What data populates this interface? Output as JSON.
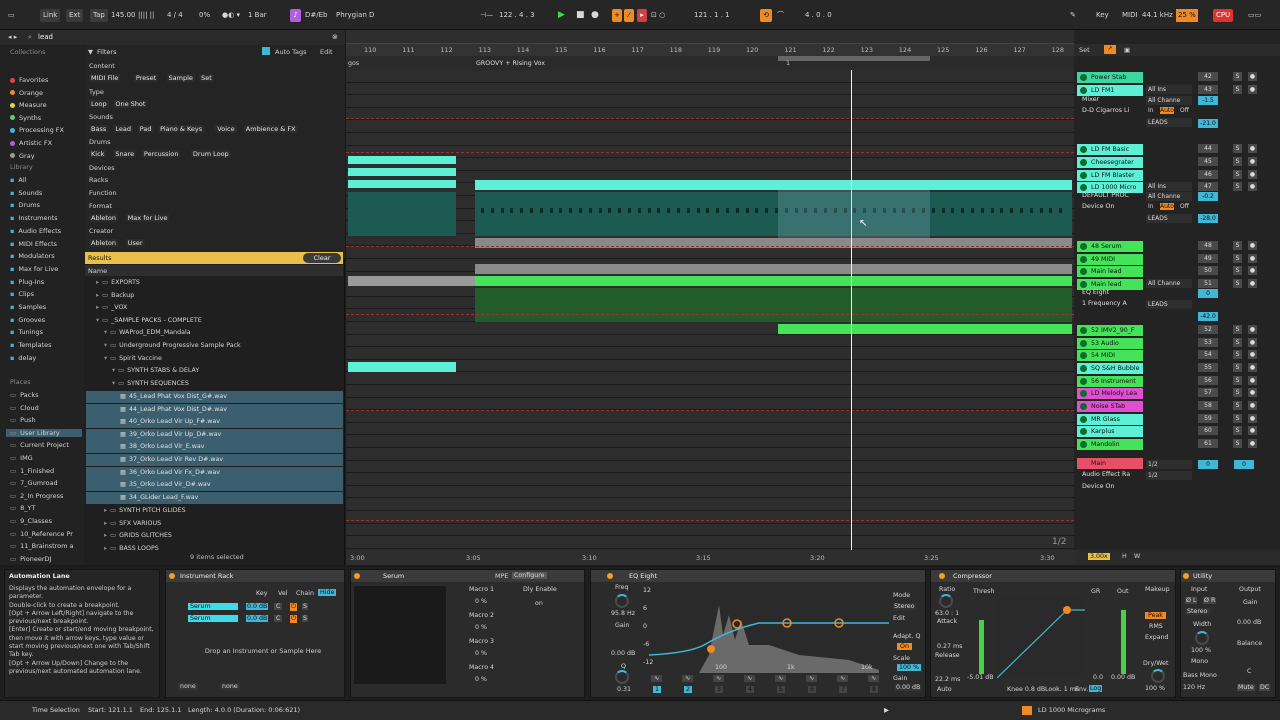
{
  "topbar": {
    "link": "Link",
    "ext": "Ext",
    "tap": "Tap",
    "tempo": "145.00",
    "meter": "4 / 4",
    "percent": "0%",
    "quant": "1 Bar",
    "key": "D#/Eb",
    "scale": "Phrygian D",
    "position": "122 .   4 .   3",
    "loop_start": "121 .   1 .   1",
    "loop_len": "4 .   0 .   0",
    "key_label": "Key",
    "midi_label": "MIDI",
    "samplerate": "44.1 kHz",
    "cpu_pct": "25 %",
    "cpu": "CPU"
  },
  "browser": {
    "search": "lead",
    "collections_title": "Collections",
    "collections": [
      {
        "label": "Favorites",
        "color": "#e04545"
      },
      {
        "label": "Orange",
        "color": "#f08a24"
      },
      {
        "label": "Measure",
        "color": "#e8d23a"
      },
      {
        "label": "Synths",
        "color": "#5fd35f"
      },
      {
        "label": "Processing FX",
        "color": "#3fb7d7"
      },
      {
        "label": "Artistic FX",
        "color": "#b05fe0"
      },
      {
        "label": "Gray",
        "color": "#9a9a9a"
      }
    ],
    "library_title": "Library",
    "library": [
      "All",
      "Sounds",
      "Drums",
      "Instruments",
      "Audio Effects",
      "MIDI Effects",
      "Modulators",
      "Max for Live",
      "Plug-Ins",
      "Clips",
      "Samples",
      "Grooves",
      "Tunings",
      "Templates",
      "delay"
    ],
    "places_title": "Places",
    "places": [
      "Packs",
      "Cloud",
      "Push",
      "User Library",
      "Current Project",
      "IMG",
      "1_Finished",
      "7_Gumroad",
      "2_In Progress",
      "8_YT",
      "9_Classes",
      "10_Reference Pr",
      "11_Brainstrom a",
      "PioneerDJ"
    ],
    "filters_label": "Filters",
    "autotags": "Auto Tags",
    "edit": "Edit",
    "content_label": "Content",
    "content": [
      "MIDI File",
      "Preset",
      "Sample",
      "Set"
    ],
    "type_label": "Type",
    "type": [
      "Loop",
      "One Shot"
    ],
    "sounds_label": "Sounds",
    "sounds": [
      "Bass",
      "Lead",
      "Pad",
      "Piano & Keys",
      "Voice",
      "Ambience & FX"
    ],
    "drums_label": "Drums",
    "drums": [
      "Kick",
      "Snare",
      "Percussion",
      "Drum Loop"
    ],
    "devices_label": "Devices",
    "racks": "Racks",
    "function_label": "Function",
    "format_label": "Format",
    "format": [
      "Ableton",
      "Max for Live"
    ],
    "creator_label": "Creator",
    "creator": [
      "Ableton",
      "User"
    ],
    "results": "Results",
    "clear": "Clear",
    "name_col": "Name",
    "tree": [
      "EXPORTS",
      "Backup",
      "_VOX",
      "_SAMPLE PACKS - COMPLETE",
      "WAProd_EDM_Mandala",
      "Underground Progressive Sample Pack",
      "Spirit Vaccine",
      "SYNTH STABS & DELAY",
      "SYNTH SEQUENCES"
    ],
    "files": [
      "45_Lead Phat Vox Dist_G#.wav",
      "44_Lead Phat Vox Dist_D#.wav",
      "40_Orko Lead Vir Up_F#.wav",
      "39_Orko Lead Vir Up_D#.wav",
      "38_Orko Lead Vir_E.wav",
      "37_Orko Lead Vir Rev D#.wav",
      "36_Orko Lead Vir Fx_D#.wav",
      "35_Orko Lead Vir_D#.wav",
      "34_GLider Lead_F.wav"
    ],
    "tree2": [
      "SYNTH PITCH GLIDES",
      "SFX VARIOUS",
      "GRIDS GLITCHES",
      "BASS LOOPS"
    ],
    "selected": "9 items selected"
  },
  "arrangement": {
    "bars": [
      "110",
      "111",
      "112",
      "113",
      "114",
      "115",
      "116",
      "117",
      "118",
      "119",
      "120",
      "121",
      "122",
      "123",
      "124",
      "125",
      "126",
      "127",
      "128"
    ],
    "locator": "GROOVY + RIsing Vox",
    "locator2": "gos",
    "loop_marker": "1",
    "times": [
      "3:00",
      "3:05",
      "3:10",
      "3:15",
      "3:20",
      "3:25",
      "3:30"
    ],
    "page": "1/2"
  },
  "mixer": {
    "set": "Set",
    "tracks": [
      {
        "name": "Power Stab",
        "color": "#3dd6a0",
        "num": "42"
      },
      {
        "name": "LD FM1",
        "color": "#5df0d6",
        "num": "43",
        "input": "All Ins"
      },
      {
        "name": "LD FM Basic",
        "color": "#5df0d6",
        "num": "44"
      },
      {
        "name": "Cheesegrater",
        "color": "#5df0d6",
        "num": "45"
      },
      {
        "name": "LD FM Blaster",
        "color": "#5df0d6",
        "num": "46"
      },
      {
        "name": "LD 1000 Micro",
        "color": "#5df0d6",
        "num": "47",
        "input": "All Ins"
      },
      {
        "name": "48 Serum",
        "color": "#44e35a",
        "num": "48"
      },
      {
        "name": "49 MIDI",
        "color": "#44e35a",
        "num": "49"
      },
      {
        "name": "Main lead",
        "color": "#44e35a",
        "num": "50"
      },
      {
        "name": "Main lead",
        "color": "#44e35a",
        "num": "51",
        "input": "All Channe"
      },
      {
        "name": "52 IMV2_90_F",
        "color": "#44e35a",
        "num": "52"
      },
      {
        "name": "53 Audio",
        "color": "#44e35a",
        "num": "53"
      },
      {
        "name": "54 MIDI",
        "color": "#44e35a",
        "num": "54"
      },
      {
        "name": "SQ S&H Bubble",
        "color": "#5df0d6",
        "num": "55"
      },
      {
        "name": "56 Instrument",
        "color": "#44e35a",
        "num": "56"
      },
      {
        "name": "LD Melody Lea",
        "color": "#e04fd0",
        "num": "57"
      },
      {
        "name": "Noise STab",
        "color": "#e04fd0",
        "num": "58"
      },
      {
        "name": "MR Glass",
        "color": "#5df0d6",
        "num": "59"
      },
      {
        "name": "Karplus",
        "color": "#5df0d6",
        "num": "60"
      },
      {
        "name": "Mandolin",
        "color": "#44e35a",
        "num": "61"
      }
    ],
    "sub1": [
      "Mixer",
      "D-D Cigarros Li"
    ],
    "sub2": [
      "DEFAULT PROC",
      "Device On"
    ],
    "sub3": [
      "EQ Eight",
      "1 Frequency A"
    ],
    "routing": {
      "all_chan": "All Channe",
      "in": "In",
      "auto": "Auto",
      "off": "Off",
      "leads": "LEADS",
      "v1": "-1.5",
      "v2": "-21.0",
      "v3": "-0.2",
      "v4": "-28.0",
      "v5": "0",
      "v6": "-42.0",
      "c": "C",
      "inf": "-∞"
    },
    "main": {
      "name": "Main",
      "effect": "Audio Effect Ra",
      "device_on": "Device On",
      "io1": "1/2",
      "io2": "1/2",
      "vol": "0",
      "vol2": "0"
    },
    "zoom": "3.00x",
    "h": "H",
    "w": "W"
  },
  "info": {
    "title": "Automation Lane",
    "text": "Displays the automation envelope for a parameter.\nDouble-click to create a breakpoint.\n[Opt + Arrow Left/Right] navigate to the previous/next breakpoint.\n[Enter] Create or start/end moving breakpoint, then move it with arrow keys, type value or start moving previous/next one with Tab/Shift Tab key.\n[Opt + Arrow Up/Down] Change to the previous/next automated automation lane."
  },
  "rack": {
    "title": "Instrument Rack",
    "key": "Key",
    "vel": "Vel",
    "chain": "Chain",
    "hide": "Hide",
    "chains": [
      {
        "name": "Serum",
        "vol": "0.0 dB",
        "pan": "C"
      },
      {
        "name": "Serum",
        "vol": "0.0 dB",
        "pan": "C"
      }
    ],
    "drop": "Drop an Instrument or Sample Here",
    "none1": "none",
    "none2": "none"
  },
  "serum": {
    "title": "Serum",
    "mpe": "MPE",
    "configure": "Configure",
    "macros": [
      {
        "name": "Macro 1",
        "val": "0 %"
      },
      {
        "name": "Macro 2",
        "val": "0 %"
      },
      {
        "name": "Macro 3",
        "val": "0 %"
      },
      {
        "name": "Macro 4",
        "val": "0 %"
      }
    ],
    "dly": "Dly Enable",
    "on": "on"
  },
  "eq": {
    "title": "EQ Eight",
    "freq": "Freq",
    "freq_v": "95.8 Hz",
    "gain": "Gain",
    "gain_v": "0.00 dB",
    "q": "Q",
    "q_v": "0.31",
    "db": [
      "12",
      "6",
      "0",
      "-6",
      "-12"
    ],
    "hz": [
      "100",
      "1k",
      "10k"
    ],
    "mode": "Mode",
    "stereo": "Stereo",
    "edit": "Edit",
    "adapt": "Adapt. Q",
    "on": "On",
    "scale": "Scale",
    "scale_v": "100 %",
    "gain2": "Gain",
    "gain2_v": "0.00 dB",
    "bands": [
      "1",
      "2",
      "3",
      "4",
      "5",
      "6",
      "7",
      "8"
    ],
    "side": "DEFAULT P..."
  },
  "comp": {
    "title": "Compressor",
    "ratio": "Ratio",
    "ratio_v": "63.0 : 1",
    "attack": "Attack",
    "attack_v": "0.27 ms",
    "release": "Release",
    "release_v": "22.2 ms",
    "auto": "Auto",
    "thresh": "Thresh",
    "gr": "GR",
    "out": "Out",
    "makeup": "Makeup",
    "peak": "Peak",
    "rms": "RMS",
    "expand": "Expand",
    "drywet": "Dry/Wet",
    "drywet_v": "100 %",
    "knee": "Knee 0.8 dB",
    "look": "Look. 1 ms",
    "env": "Env.",
    "log": "Log",
    "thresh_v": "-5.01 dB",
    "zero": "0.0",
    "zero2": "0.00 dB"
  },
  "utility": {
    "title": "Utility",
    "input": "Input",
    "output": "Output",
    "ol": "Ø L",
    "or": "Ø R",
    "stereo": "Stereo",
    "width": "Width",
    "width_v": "100 %",
    "mono": "Mono",
    "bassmono": "Bass Mono",
    "hz": "120 Hz",
    "gain": "Gain",
    "gain_v": "0.00 dB",
    "balance": "Balance",
    "c": "C",
    "mute": "Mute",
    "dc": "DC"
  },
  "status": {
    "mode": "Time Selection",
    "start": "Start: 121.1.1",
    "end": "End: 125.1.1",
    "length": "Length: 4.0.0 (Duration: 0:06:621)",
    "track": "LD 1000 Micrograms"
  }
}
